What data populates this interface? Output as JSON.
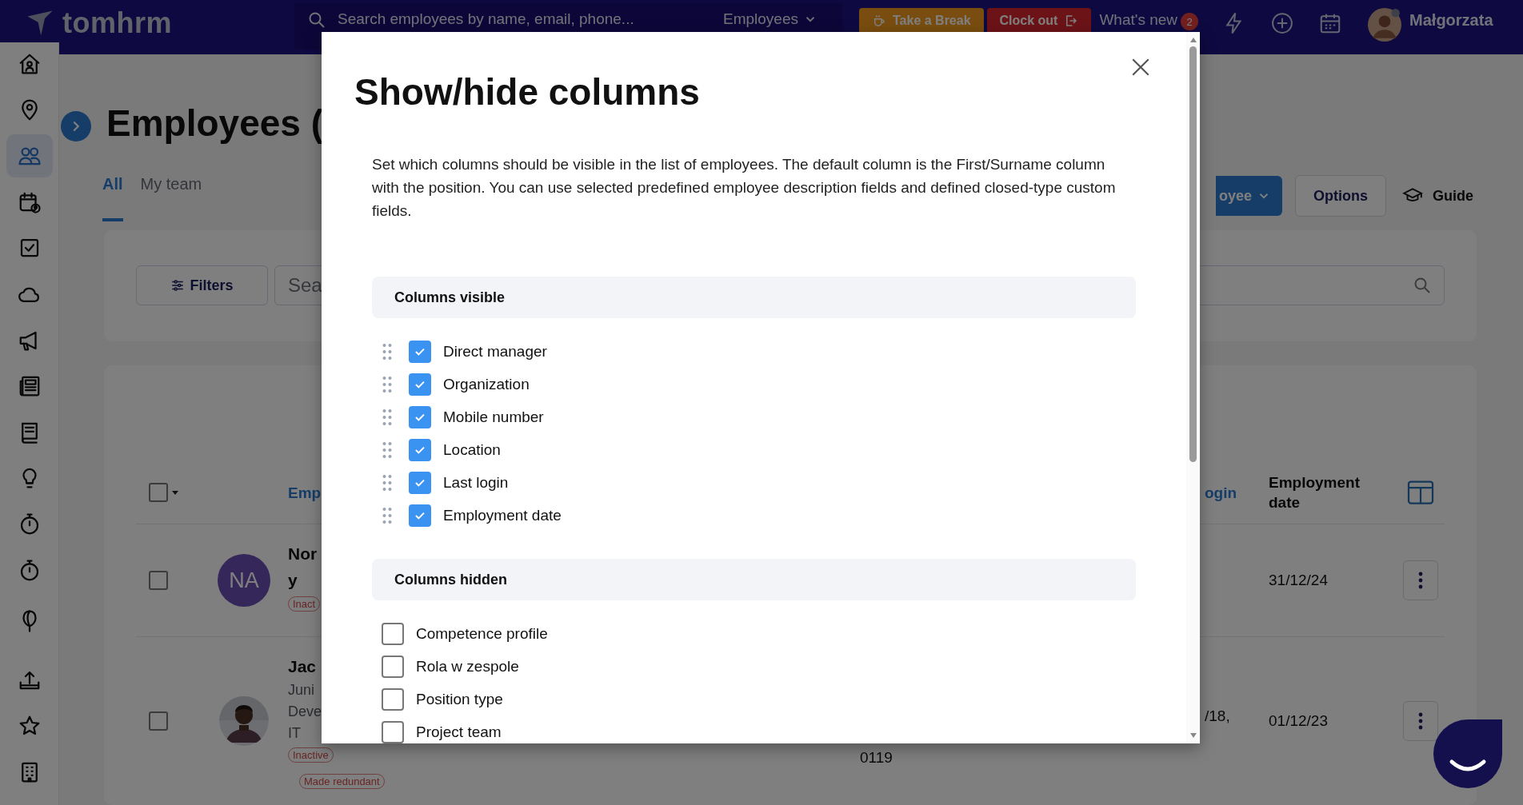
{
  "topbar": {
    "logo": "tomhrm",
    "search": {
      "placeholder": "Search employees by name, email, phone..."
    },
    "scope": "Employees",
    "break_button": "Take a Break",
    "clock_out_button": "Clock out",
    "whats_new": "What's new",
    "whats_new_count": "2",
    "user": "Małgorzata"
  },
  "sidebar": {
    "items": [
      {
        "selected": false
      },
      {
        "selected": false
      },
      {
        "selected": true
      },
      {
        "selected": false
      },
      {
        "selected": false
      },
      {
        "selected": false
      },
      {
        "selected": false
      },
      {
        "selected": false
      },
      {
        "selected": false
      },
      {
        "selected": false
      },
      {
        "selected": false
      },
      {
        "selected": false
      },
      {
        "selected": false
      },
      {
        "selected": false
      },
      {
        "selected": false
      },
      {
        "selected": false
      }
    ]
  },
  "page": {
    "title": "Employees (",
    "tabs": [
      {
        "label": "All",
        "selected": true
      },
      {
        "label": "My team",
        "selected": false
      }
    ],
    "add_button": "oyee",
    "options_button": "Options",
    "guide_button": "Guide",
    "filters_button": "Filters",
    "search": {
      "placeholder": "Sea"
    }
  },
  "table": {
    "select_all_checked": false,
    "columns": [
      "Emp",
      "ogin",
      "Employment date"
    ],
    "rows": [
      {
        "checked": false,
        "avatar": {
          "kind": "initials",
          "initials": "NA"
        },
        "name_lines": [
          "Nor",
          "y"
        ],
        "details": [],
        "tags": [
          "Inact"
        ],
        "column_4": [],
        "column_5": [],
        "date": "31/12/24"
      },
      {
        "checked": false,
        "avatar": {
          "kind": "picture"
        },
        "name_lines": [
          "Jac"
        ],
        "details": [
          "Juni",
          "Deve",
          "IT"
        ],
        "tags": [
          "Inactive",
          "Made redundant"
        ],
        "column_4": [
          "0119"
        ],
        "column_5": [
          "/18,"
        ],
        "date": "01/12/23"
      }
    ]
  },
  "modal": {
    "title": "Show/hide columns",
    "description": "Set which columns should be visible in the list of employees. The default column is the First/Surname column with the position. You can use selected predefined employee description fields and defined closed-type custom fields.",
    "visible_header": "Columns visible",
    "visible": [
      {
        "label": "Direct manager",
        "checked": true
      },
      {
        "label": "Organization",
        "checked": true
      },
      {
        "label": "Mobile number",
        "checked": true
      },
      {
        "label": "Location",
        "checked": true
      },
      {
        "label": "Last login",
        "checked": true
      },
      {
        "label": "Employment date",
        "checked": true
      }
    ],
    "hidden_header": "Columns hidden",
    "hidden": [
      {
        "label": "Competence profile",
        "checked": false
      },
      {
        "label": "Rola w zespole",
        "checked": false
      },
      {
        "label": "Position type",
        "checked": false
      },
      {
        "label": "Project team",
        "checked": false
      }
    ]
  }
}
